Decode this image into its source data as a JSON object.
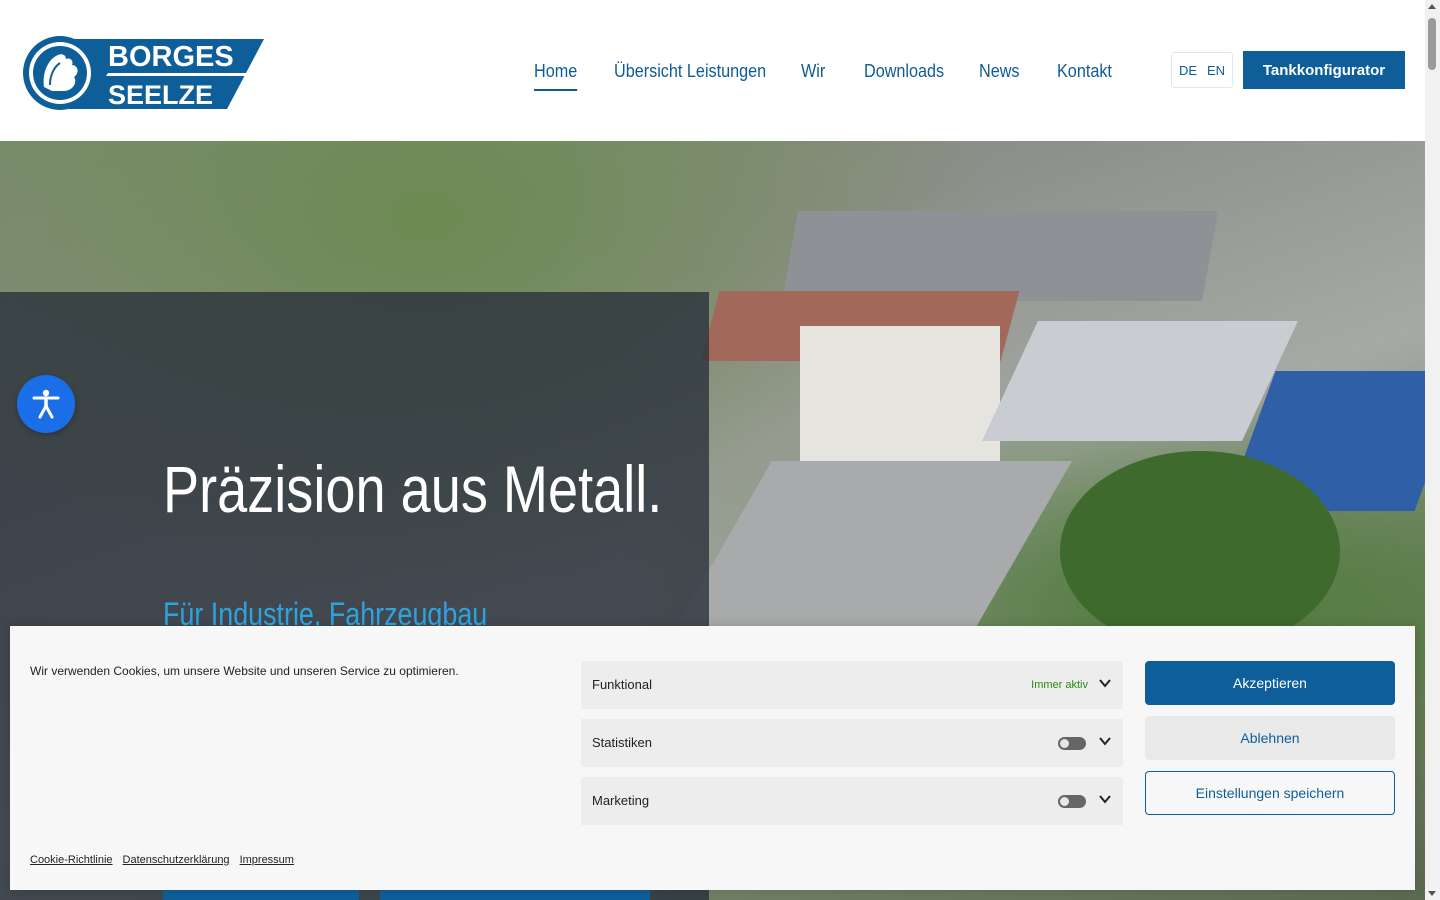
{
  "brand": {
    "logo_line1": "BORGES",
    "logo_line2": "SEELZE",
    "primary_color": "#0e5f99",
    "accent_color": "#2fa3e0"
  },
  "nav": {
    "items": [
      {
        "label": "Home",
        "active": true
      },
      {
        "label": "Übersicht Leistungen",
        "active": false
      },
      {
        "label": "Wir",
        "active": false
      },
      {
        "label": "Downloads",
        "active": false
      },
      {
        "label": "News",
        "active": false
      },
      {
        "label": "Kontakt",
        "active": false
      }
    ]
  },
  "language": {
    "options": [
      "DE",
      "EN"
    ],
    "selected": "DE"
  },
  "header_cta": "Tankkonfigurator",
  "hero": {
    "title": "Präzision aus Metall.",
    "subtitle": "Für Industrie, Fahrzeugbau"
  },
  "accessibility": {
    "icon": "accessibility-icon",
    "color": "#1a6fe8"
  },
  "cookie_banner": {
    "text": "Wir verwenden Cookies, um unsere Website und unseren Service zu optimieren.",
    "categories": [
      {
        "label": "Funktional",
        "status": "Immer aktiv"
      },
      {
        "label": "Statistiken",
        "toggle": "off"
      },
      {
        "label": "Marketing",
        "toggle": "off"
      }
    ],
    "buttons": {
      "accept": "Akzeptieren",
      "deny": "Ablehnen",
      "save": "Einstellungen speichern"
    },
    "links": [
      "Cookie-Richtlinie",
      "Datenschutzerklärung",
      "Impressum"
    ]
  }
}
